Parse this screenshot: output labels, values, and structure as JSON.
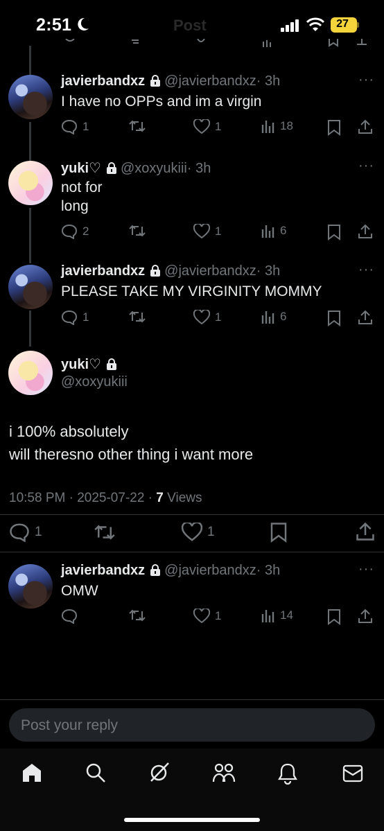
{
  "status": {
    "time": "2:51",
    "battery": "27",
    "faded_title": "Post"
  },
  "replies_above": [
    {
      "id": "r1",
      "name": "javierbandxz",
      "handle": "@javierbandxz",
      "time": "· 3h",
      "text": "I have no OPPs and im a virgin",
      "replies": "1",
      "reposts": "",
      "likes": "1",
      "views": "18"
    },
    {
      "id": "r2",
      "name": "yuki",
      "handle": "@xoxyukiii",
      "time": "· 3h",
      "text": "not for\nlong",
      "replies": "2",
      "reposts": "",
      "likes": "1",
      "views": "6"
    },
    {
      "id": "r3",
      "name": "javierbandxz",
      "handle": "@javierbandxz",
      "time": "· 3h",
      "text": "PLEASE TAKE MY VIRGINITY MOMMY",
      "replies": "1",
      "reposts": "",
      "likes": "1",
      "views": "6"
    }
  ],
  "main_post": {
    "name": "yuki",
    "handle": "@xoxyukiii",
    "text": "i 100% absolutely\nwill theresno other thing i want more",
    "timestamp": "10:58 PM · 2025-07-22 · ",
    "views_count": "7",
    "views_label": " Views",
    "replies": "1",
    "reposts": "",
    "likes": "1"
  },
  "reply_below": {
    "name": "javierbandxz",
    "handle": "@javierbandxz",
    "time": "· 3h",
    "text": "OMW",
    "replies": "",
    "reposts": "",
    "likes": "1",
    "views": "14"
  },
  "reply_box": {
    "placeholder": "Post your reply"
  },
  "tabbar": [
    "home-icon",
    "search-icon",
    "grok-icon",
    "communities-icon",
    "notifications-icon",
    "messages-icon"
  ]
}
